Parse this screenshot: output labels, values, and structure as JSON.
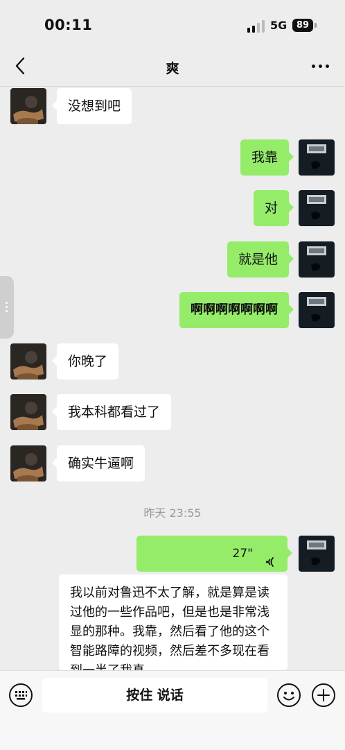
{
  "status_bar": {
    "time": "00:11",
    "network": "5G",
    "battery": "89"
  },
  "nav": {
    "title": "爽"
  },
  "messages": [
    {
      "side": "in",
      "text": "没想到吧"
    },
    {
      "side": "out",
      "text": "我靠"
    },
    {
      "side": "out",
      "text": "对"
    },
    {
      "side": "out",
      "text": "就是他"
    },
    {
      "side": "out",
      "text": "啊啊啊啊啊啊啊"
    },
    {
      "side": "in",
      "text": "你晚了"
    },
    {
      "side": "in",
      "text": "我本科都看过了"
    },
    {
      "side": "in",
      "text": "确实牛逼啊"
    }
  ],
  "timestamp": "昨天 23:55",
  "voice_message": {
    "duration": "27\"",
    "transcript": "我以前对鲁迅不太了解，就是算是读过他的一些作品吧，但是也是非常浅显的那种。我靠，然后看了他的这个智能路障的视频，然后差不多现在看到一半了我真"
  },
  "input_bar": {
    "hold_to_talk": "按住 说话"
  },
  "icons": {
    "back": "chevron-left-icon",
    "more": "more-horizontal-icon",
    "keyboard": "keyboard-icon",
    "emoji": "emoji-icon",
    "plus": "plus-circle-icon",
    "voice": "voice-wave-icon"
  },
  "colors": {
    "background": "#ededed",
    "outgoing_bubble": "#95ec69",
    "incoming_bubble": "#ffffff"
  }
}
